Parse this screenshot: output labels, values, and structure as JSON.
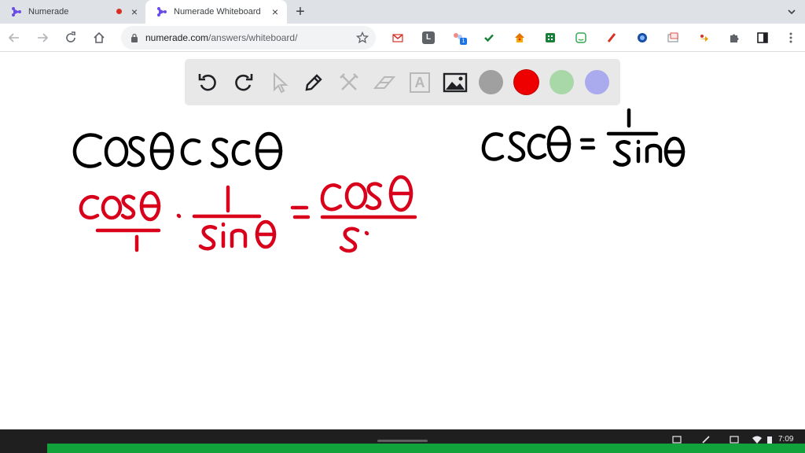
{
  "browser": {
    "tabs": [
      {
        "title": "Numerade",
        "recording": true,
        "active": false
      },
      {
        "title": "Numerade Whiteboard",
        "recording": false,
        "active": true
      }
    ],
    "close_glyph": "×",
    "new_tab_glyph": "+",
    "url_host": "numerade.com",
    "url_path": "/answers/whiteboard/",
    "extensions": [
      "gmail-icon",
      "letter-l-icon",
      "puzzle-notification-icon",
      "checkmark-icon",
      "house-icon",
      "grid-icon",
      "face-icon",
      "pen-icon",
      "globe-icon",
      "picture-icon",
      "arrow-icon",
      "extensions-puzzle-icon",
      "side-panel-icon",
      "menu-dots-icon"
    ],
    "extension_badge": "1",
    "extension_letter": "L"
  },
  "whiteboard": {
    "tools": [
      "undo-icon",
      "redo-icon",
      "pointer-icon",
      "pen-icon",
      "tools-icon",
      "eraser-icon",
      "text-icon",
      "image-icon"
    ],
    "text_tool_glyph": "A",
    "colors": [
      "#a0a0a0",
      "#ee0000",
      "#a8d8a8",
      "#aaaaee"
    ],
    "selected_color": "#ee0000",
    "ink_black": "#000000",
    "ink_red": "#d9001b"
  },
  "shelf": {
    "time": "7:09",
    "accent": "#12a23b"
  }
}
